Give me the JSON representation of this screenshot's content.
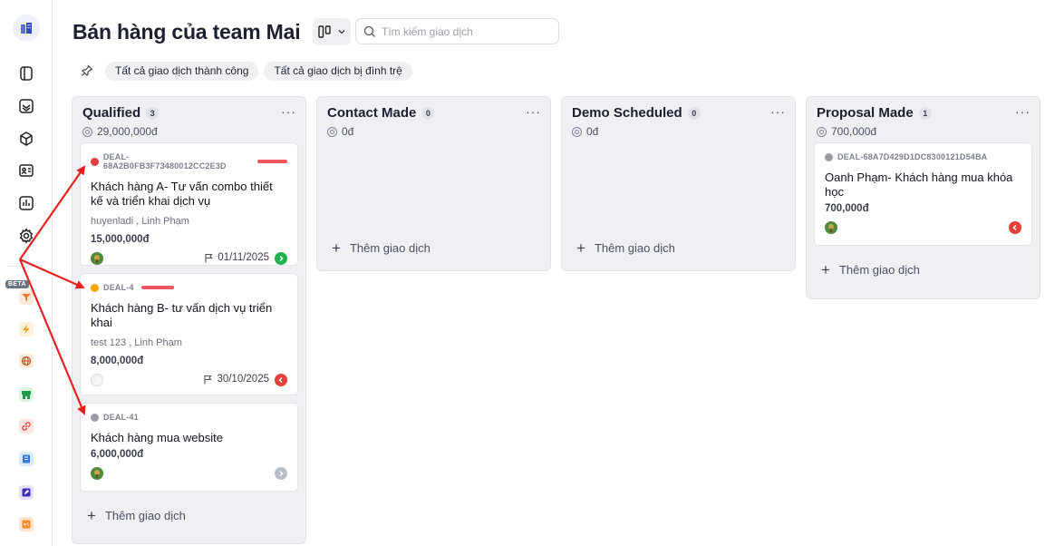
{
  "header": {
    "title": "Bán hàng của team Mai",
    "search_placeholder": "Tìm kiếm giao dịch"
  },
  "sidebar": {
    "beta_label": "BETA",
    "nav_icons": [
      "logo-icon",
      "board-icon",
      "inbox-icon",
      "product-box-icon",
      "contact-card-icon",
      "report-chart-icon",
      "gear-icon"
    ],
    "app_icons": [
      "funnel-icon",
      "bolt-icon",
      "globe-icon",
      "store-icon",
      "link-icon",
      "book-icon",
      "edit-icon",
      "survey-icon"
    ]
  },
  "filters": [
    {
      "label": "Tất cả giao dịch thành công"
    },
    {
      "label": "Tất cả giao dịch bị đình trệ"
    }
  ],
  "labels": {
    "add_deal": "Thêm giao dịch"
  },
  "columns": [
    {
      "title": "Qualified",
      "count": "3",
      "total": "29,000,000đ",
      "cards": [
        {
          "id": "DEAL-68A2B0FB3F73480012CC2E3D",
          "dot_color": "#e53e3e",
          "title": "Khách hàng A- Tư vấn combo thiết kế và triển khai dịch vụ",
          "people": "huyenladi , Linh Phạm",
          "amount": "15,000,000đ",
          "due": "01/11/2025",
          "status": "green"
        },
        {
          "id": "DEAL-4",
          "dot_color": "#f5a700",
          "title": "Khách hàng B- tư vấn dịch vụ triển khai",
          "people": "test 123 , Linh Phạm",
          "amount": "8,000,000đ",
          "due": "30/10/2025",
          "status": "red"
        },
        {
          "id": "DEAL-41",
          "dot_color": "#9a9ca3",
          "title": "Khách hàng mua website",
          "amount": "6,000,000đ",
          "status": "gray"
        }
      ]
    },
    {
      "title": "Contact Made",
      "count": "0",
      "total": "0đ",
      "cards": []
    },
    {
      "title": "Demo Scheduled",
      "count": "0",
      "total": "0đ",
      "cards": []
    },
    {
      "title": "Proposal Made",
      "count": "1",
      "total": "700,000đ",
      "cards": [
        {
          "id": "DEAL-68A7D429D1DC8300121D54BA",
          "dot_color": "#9a9ca3",
          "title": "Oanh Phạm- Khách hàng mua khóa học",
          "amount": "700,000đ",
          "status": "red"
        }
      ]
    }
  ],
  "colors": {
    "accent_red": "#e8211f",
    "status_green": "#22b24c",
    "status_red": "#e5403a",
    "status_gray": "#b8bcc6"
  }
}
